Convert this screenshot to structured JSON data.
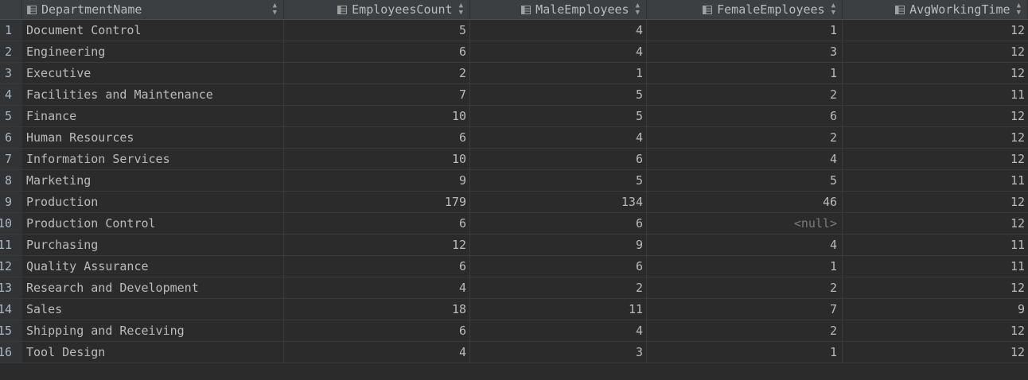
{
  "columns": {
    "department": "DepartmentName",
    "employees_count": "EmployeesCount",
    "male_employees": "MaleEmployees",
    "female_employees": "FemaleEmployees",
    "avg_working_time": "AvgWorkingTime"
  },
  "icons": {
    "column_icon": "table-column-icon",
    "sort_icon": "sort-toggle-icon"
  },
  "rows": [
    {
      "num": "1",
      "department": "Document Control",
      "employees": "5",
      "male": "4",
      "female": "1",
      "avg": "12"
    },
    {
      "num": "2",
      "department": "Engineering",
      "employees": "6",
      "male": "4",
      "female": "3",
      "avg": "12"
    },
    {
      "num": "3",
      "department": "Executive",
      "employees": "2",
      "male": "1",
      "female": "1",
      "avg": "12"
    },
    {
      "num": "4",
      "department": "Facilities and Maintenance",
      "employees": "7",
      "male": "5",
      "female": "2",
      "avg": "11"
    },
    {
      "num": "5",
      "department": "Finance",
      "employees": "10",
      "male": "5",
      "female": "6",
      "avg": "12"
    },
    {
      "num": "6",
      "department": "Human Resources",
      "employees": "6",
      "male": "4",
      "female": "2",
      "avg": "12"
    },
    {
      "num": "7",
      "department": "Information Services",
      "employees": "10",
      "male": "6",
      "female": "4",
      "avg": "12"
    },
    {
      "num": "8",
      "department": "Marketing",
      "employees": "9",
      "male": "5",
      "female": "5",
      "avg": "11"
    },
    {
      "num": "9",
      "department": "Production",
      "employees": "179",
      "male": "134",
      "female": "46",
      "avg": "12"
    },
    {
      "num": "10",
      "department": "Production Control",
      "employees": "6",
      "male": "6",
      "female": "<null>",
      "avg": "12"
    },
    {
      "num": "11",
      "department": "Purchasing",
      "employees": "12",
      "male": "9",
      "female": "4",
      "avg": "11"
    },
    {
      "num": "12",
      "department": "Quality Assurance",
      "employees": "6",
      "male": "6",
      "female": "1",
      "avg": "11"
    },
    {
      "num": "13",
      "department": "Research and Development",
      "employees": "4",
      "male": "2",
      "female": "2",
      "avg": "12"
    },
    {
      "num": "14",
      "department": "Sales",
      "employees": "18",
      "male": "11",
      "female": "7",
      "avg": "9"
    },
    {
      "num": "15",
      "department": "Shipping and Receiving",
      "employees": "6",
      "male": "4",
      "female": "2",
      "avg": "12"
    },
    {
      "num": "16",
      "department": "Tool Design",
      "employees": "4",
      "male": "3",
      "female": "1",
      "avg": "12"
    }
  ],
  "colors": {
    "background": "#2b2b2b",
    "header_background": "#3c3f41",
    "text": "#bbbbbb",
    "null_text": "#7a7a7a"
  }
}
